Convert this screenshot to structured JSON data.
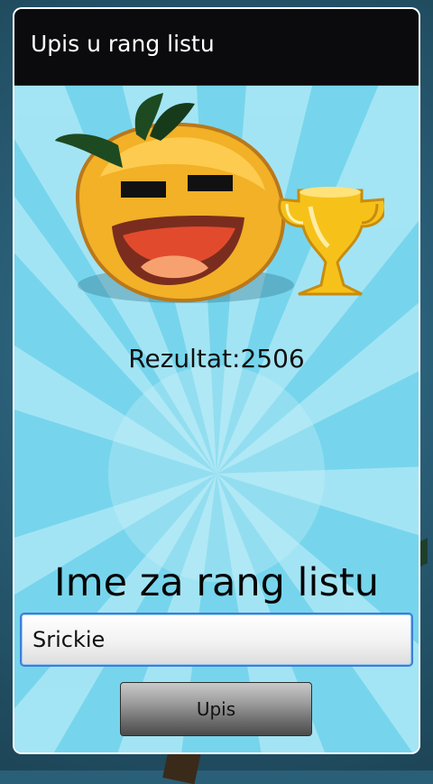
{
  "dialog": {
    "title": "Upis u rang listu",
    "score_text": "Rezultat:2506",
    "name_heading": "Ime za rang listu",
    "name_input_value": "Srickie",
    "submit_label": "Upis"
  },
  "colors": {
    "titlebar_bg": "#0b0b0d",
    "content_bg": "#7ad7ee",
    "ray_light": "#b6ecf8",
    "mascot_body": "#f2b126",
    "leaf": "#1e4a22",
    "trophy": "#f6c21a",
    "input_focus_border": "#3c7fd6"
  },
  "icons": {
    "mascot": "smiling-fruit-mascot",
    "trophy": "trophy-icon"
  }
}
